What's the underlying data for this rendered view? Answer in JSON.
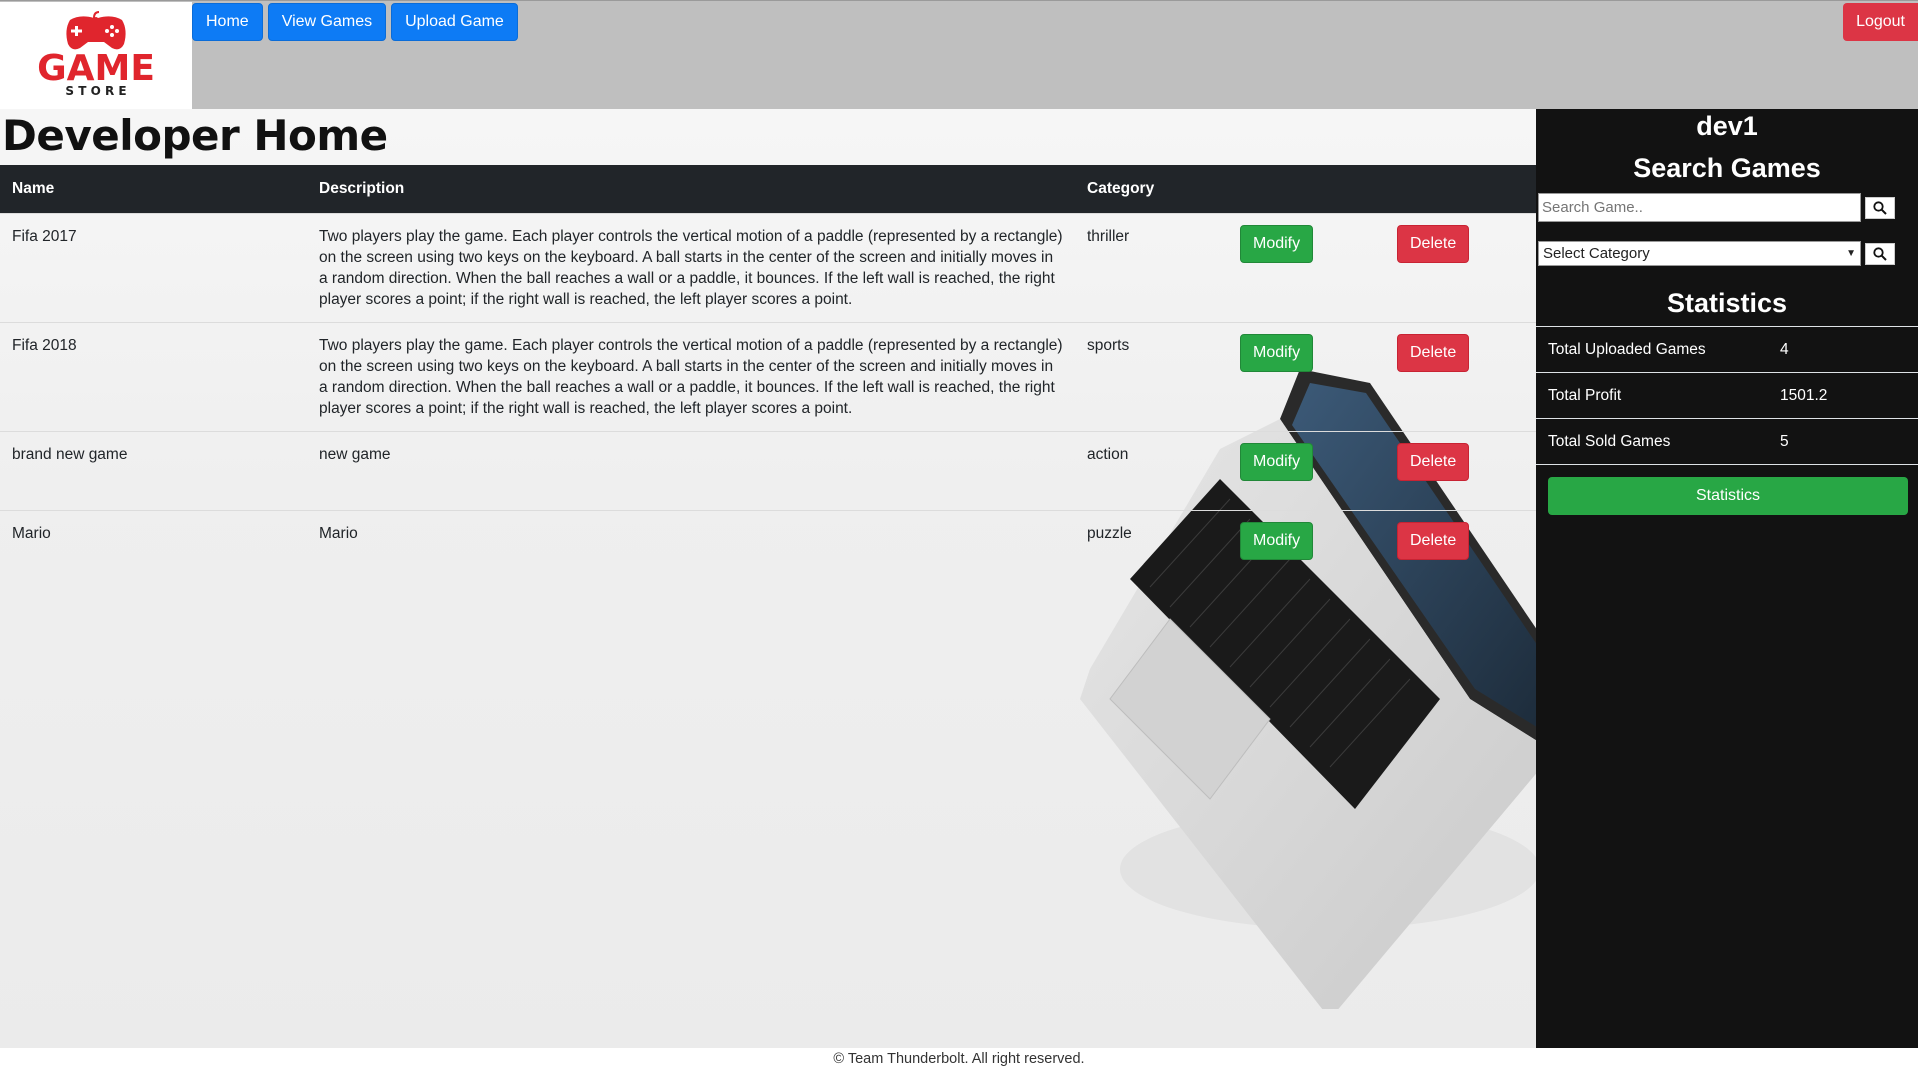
{
  "brand": {
    "logo_word": "GAME",
    "logo_sub": "S T O R E",
    "logo_color": "#e0252d"
  },
  "nav": {
    "items": [
      {
        "label": "Home"
      },
      {
        "label": "View Games"
      },
      {
        "label": "Upload Game"
      }
    ],
    "logout_label": "Logout"
  },
  "page": {
    "title": "Developer Home"
  },
  "table": {
    "headers": {
      "name": "Name",
      "description": "Description",
      "category": "Category"
    },
    "rows": [
      {
        "name": "Fifa 2017",
        "description": "Two players play the game. Each player controls the vertical motion of a paddle (represented by a rectangle) on the screen using two keys on the keyboard. A ball starts in the center of the screen and initially moves in a random direction. When the ball reaches a wall or a paddle, it bounces. If the left wall is reached, the right player scores a point; if the right wall is reached, the left player scores a point.",
        "category": "thriller",
        "modify_label": "Modify",
        "delete_label": "Delete"
      },
      {
        "name": "Fifa 2018",
        "description": "Two players play the game. Each player controls the vertical motion of a paddle (represented by a rectangle) on the screen using two keys on the keyboard. A ball starts in the center of the screen and initially moves in a random direction. When the ball reaches a wall or a paddle, it bounces. If the left wall is reached, the right player scores a point; if the right wall is reached, the left player scores a point.",
        "category": "sports",
        "modify_label": "Modify",
        "delete_label": "Delete"
      },
      {
        "name": "brand new game",
        "description": "new game",
        "category": "action",
        "modify_label": "Modify",
        "delete_label": "Delete"
      },
      {
        "name": "Mario",
        "description": "Mario",
        "category": "puzzle",
        "modify_label": "Modify",
        "delete_label": "Delete"
      }
    ]
  },
  "sidebar": {
    "username": "dev1",
    "search_heading": "Search Games",
    "search_placeholder": "Search Game..",
    "search_icon": "search-icon",
    "category_select": "Select Category",
    "stats_heading": "Statistics",
    "stats": [
      {
        "label": "Total Uploaded Games",
        "value": "4"
      },
      {
        "label": "Total Profit",
        "value": "1501.2"
      },
      {
        "label": "Total Sold Games",
        "value": "5"
      }
    ],
    "stats_button": "Statistics"
  },
  "footer": {
    "text": "© Team Thunderbolt. All right reserved."
  },
  "colors": {
    "primary": "#0d7bf5",
    "success": "#28a745",
    "danger": "#dc3545",
    "dark": "#212529",
    "sidebar_bg": "#121212",
    "topbar_bg": "#bfbfbf"
  }
}
